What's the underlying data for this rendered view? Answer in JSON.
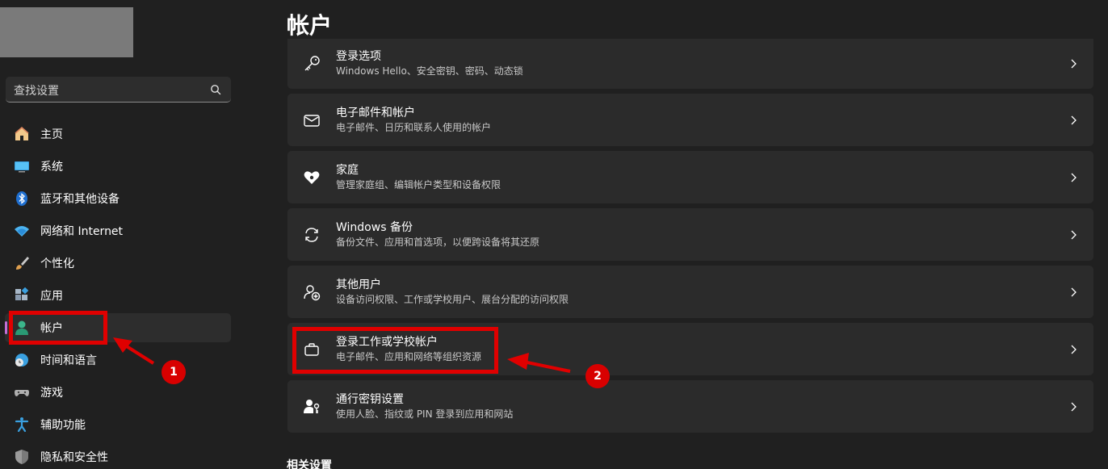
{
  "search": {
    "placeholder": "查找设置"
  },
  "sidebar": {
    "items": [
      {
        "label": "主页"
      },
      {
        "label": "系统"
      },
      {
        "label": "蓝牙和其他设备"
      },
      {
        "label": "网络和 Internet"
      },
      {
        "label": "个性化"
      },
      {
        "label": "应用"
      },
      {
        "label": "帐户"
      },
      {
        "label": "时间和语言"
      },
      {
        "label": "游戏"
      },
      {
        "label": "辅助功能"
      },
      {
        "label": "隐私和安全性"
      }
    ]
  },
  "main": {
    "title": "帐户",
    "cards": [
      {
        "title": "登录选项",
        "subtitle": "Windows Hello、安全密钥、密码、动态锁"
      },
      {
        "title": "电子邮件和帐户",
        "subtitle": "电子邮件、日历和联系人使用的帐户"
      },
      {
        "title": "家庭",
        "subtitle": "管理家庭组、编辑帐户类型和设备权限"
      },
      {
        "title": "Windows 备份",
        "subtitle": "备份文件、应用和首选项，以便跨设备将其还原"
      },
      {
        "title": "其他用户",
        "subtitle": "设备访问权限、工作或学校用户、展台分配的访问权限"
      },
      {
        "title": "登录工作或学校帐户",
        "subtitle": "电子邮件、应用和网络等组织资源"
      },
      {
        "title": "通行密钥设置",
        "subtitle": "使用人脸、指纹或 PIN 登录到应用和网站"
      }
    ],
    "related_heading": "相关设置"
  },
  "annotations": {
    "badge1": "1",
    "badge2": "2"
  },
  "colors": {
    "accent": "#c26fd6",
    "highlight": "#e00000",
    "background": "#202020",
    "card": "#2b2b2b"
  }
}
